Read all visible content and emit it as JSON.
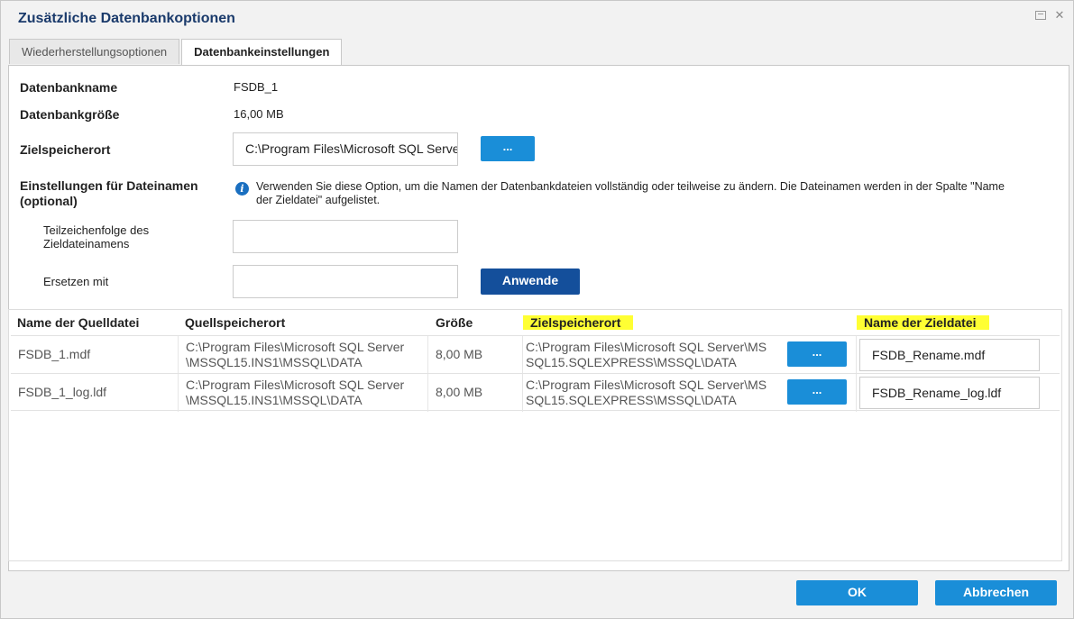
{
  "window": {
    "title": "Zusätzliche Datenbankoptionen"
  },
  "tabs": [
    {
      "label": "Wiederherstellungsoptionen",
      "active": false
    },
    {
      "label": "Datenbankeinstellungen",
      "active": true
    }
  ],
  "settings": {
    "db_name_label": "Datenbankname",
    "db_name_value": "FSDB_1",
    "db_size_label": "Datenbankgröße",
    "db_size_value": "16,00 MB",
    "target_location_label": "Zielspeicherort",
    "target_location_value": "C:\\Program Files\\Microsoft SQL Server",
    "browse_label": "...",
    "filename_settings_label": "Einstellungen für Dateinamen (optional)",
    "info_text": "Verwenden Sie diese Option, um die Namen der Datenbankdateien vollständig oder teilweise zu ändern. Die Dateinamen werden in der Spalte \"Name der Zieldatei\" aufgelistet.",
    "substring_label": "Teilzeichenfolge des Zieldateinamens",
    "substring_value": "",
    "replace_label": "Ersetzen mit",
    "replace_value": "",
    "apply_label": "Anwende"
  },
  "grid": {
    "columns": [
      "Name der Quelldatei",
      "Quellspeicherort",
      "Größe",
      "Zielspeicherort",
      "Name der Zieldatei"
    ],
    "rows": [
      {
        "source_name": "FSDB_1.mdf",
        "source_location_1": "C:\\Program Files\\Microsoft SQL Server",
        "source_location_2": "\\MSSQL15.INS1\\MSSQL\\DATA",
        "size": "8,00 MB",
        "target_location_1": "C:\\Program Files\\Microsoft SQL Server\\MS",
        "target_location_2": "SQL15.SQLEXPRESS\\MSSQL\\DATA",
        "browse_label": "...",
        "target_name": "FSDB_Rename.mdf"
      },
      {
        "source_name": "FSDB_1_log.ldf",
        "source_location_1": "C:\\Program Files\\Microsoft SQL Server",
        "source_location_2": "\\MSSQL15.INS1\\MSSQL\\DATA",
        "size": "8,00 MB",
        "target_location_1": "C:\\Program Files\\Microsoft SQL Server\\MS",
        "target_location_2": "SQL15.SQLEXPRESS\\MSSQL\\DATA",
        "browse_label": "...",
        "target_name": "FSDB_Rename_log.ldf"
      }
    ]
  },
  "footer": {
    "ok_label": "OK",
    "cancel_label": "Abbrechen"
  },
  "colors": {
    "accent": "#1a8ed8",
    "apply_button": "#144f9b",
    "title_text": "#1a3a6b",
    "highlight": "#ffff33"
  }
}
